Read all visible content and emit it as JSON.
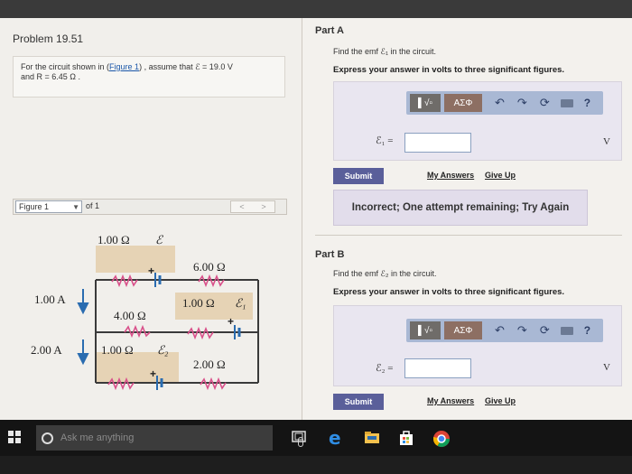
{
  "problem": {
    "title": "Problem 19.51",
    "text_before": "For the circuit shown in (",
    "figure_link": "Figure 1",
    "text_after": ") , assume that ℰ = 19.0 V",
    "text_line2": "and R = 6.45 Ω ."
  },
  "figure": {
    "label": "Figure 1",
    "of": "of 1",
    "prev": "<",
    "next": ">"
  },
  "circuit": {
    "r_top": "1.00 Ω",
    "emf_top": "ℰ",
    "r_6": "6.00 Ω",
    "i1": "1.00 A",
    "r_4": "4.00 Ω",
    "r_mid": "1.00 Ω",
    "emf1": "ℰ₁",
    "i2": "2.00 A",
    "r_bot": "1.00 Ω",
    "emf2": "ℰ₂",
    "r_2": "2.00 Ω"
  },
  "partA": {
    "title": "Part A",
    "question": "Find the emf ℰ₁ in the circuit.",
    "instruction": "Express your answer in volts to three significant figures.",
    "toolbar_grid": "▌√▫",
    "toolbar_greek": "AΣΦ",
    "eq_label": "ℰ₁ =",
    "unit": "V",
    "submit": "Submit",
    "my_answers": "My Answers",
    "give_up": "Give Up",
    "feedback": "Incorrect; One attempt remaining; Try Again"
  },
  "partB": {
    "title": "Part B",
    "question": "Find the emf ℰ₂ in the circuit.",
    "instruction": "Express your answer in volts to three significant figures.",
    "toolbar_grid": "▌√▫",
    "toolbar_greek": "AΣΦ",
    "eq_label": "ℰ₂ =",
    "unit": "V",
    "submit": "Submit",
    "my_answers": "My Answers",
    "give_up": "Give Up"
  },
  "taskbar": {
    "search_placeholder": "Ask me anything"
  }
}
